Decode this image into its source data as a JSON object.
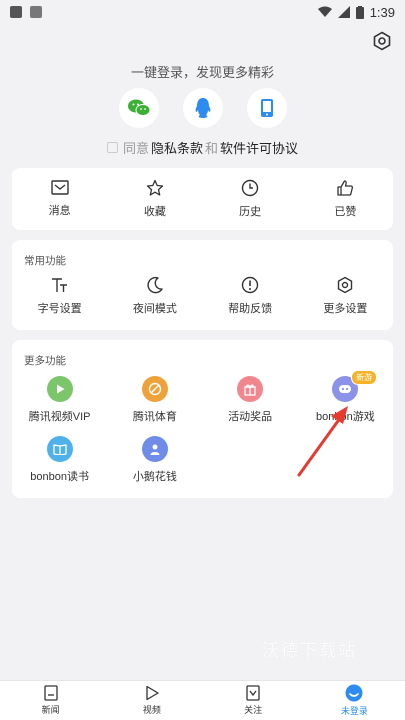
{
  "status_bar": {
    "time": "1:39"
  },
  "login": {
    "hint": "一键登录，发现更多精彩",
    "agree_prefix": "同意",
    "privacy": "隐私条款",
    "and": "和",
    "license": "软件许可协议"
  },
  "quick": [
    {
      "label": "消息",
      "icon": "message-icon"
    },
    {
      "label": "收藏",
      "icon": "star-icon"
    },
    {
      "label": "历史",
      "icon": "clock-icon"
    },
    {
      "label": "已赞",
      "icon": "thumbs-up-icon"
    }
  ],
  "common": {
    "title": "常用功能",
    "items": [
      {
        "label": "字号设置",
        "icon": "font-size-icon"
      },
      {
        "label": "夜间模式",
        "icon": "moon-icon"
      },
      {
        "label": "帮助反馈",
        "icon": "help-icon"
      },
      {
        "label": "更多设置",
        "icon": "settings-icon"
      }
    ]
  },
  "more": {
    "title": "更多功能",
    "items": [
      {
        "label": "腾讯视频VIP",
        "icon": "play-icon",
        "color": "#7bc66a"
      },
      {
        "label": "腾讯体育",
        "icon": "sports-icon",
        "color": "#f0a23a"
      },
      {
        "label": "活动奖品",
        "icon": "gift-icon",
        "color": "#f2868f"
      },
      {
        "label": "bonbon游戏",
        "icon": "game-icon",
        "color": "#8a93e8",
        "badge": "新游"
      },
      {
        "label": "bonbon读书",
        "icon": "book-icon",
        "color": "#4fb0ea"
      },
      {
        "label": "小鹅花钱",
        "icon": "wallet-icon",
        "color": "#6f8ce8"
      }
    ]
  },
  "watermark": "沃德下载站",
  "tabs": [
    {
      "label": "新闻",
      "icon": "news-icon"
    },
    {
      "label": "视频",
      "icon": "video-icon"
    },
    {
      "label": "关注",
      "icon": "follow-icon"
    },
    {
      "label": "未登录",
      "icon": "profile-icon",
      "active": true
    }
  ],
  "colors": {
    "accent": "#2d8cf0",
    "wechat": "#3cb034",
    "qq": "#2d8cf0",
    "arrow": "#e63a2e"
  }
}
